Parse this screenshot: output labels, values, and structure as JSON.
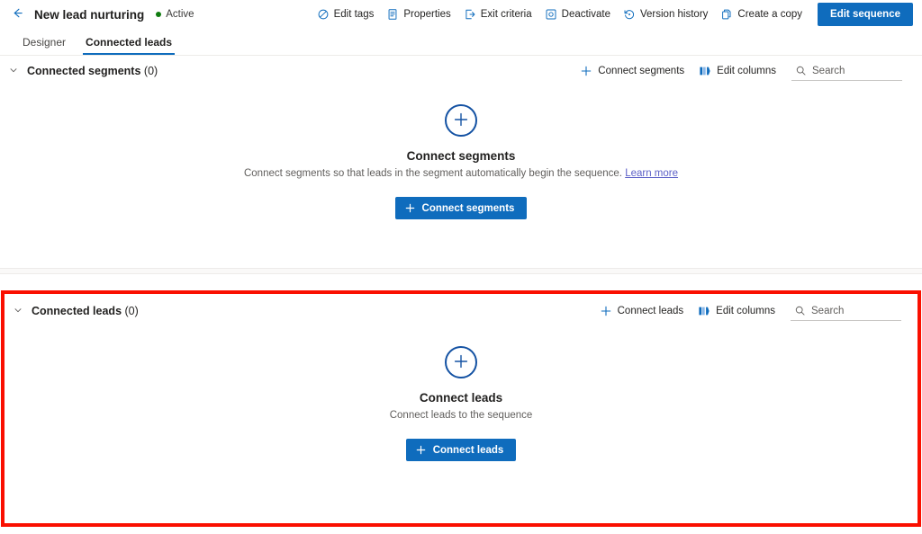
{
  "commandbar": {
    "back_icon": "arrow-left-icon",
    "title": "New lead nurturing",
    "status": "Active",
    "status_color": "#107c10",
    "actions": [
      {
        "label": "Edit tags",
        "icon": "tag-icon"
      },
      {
        "label": "Properties",
        "icon": "document-properties-icon"
      },
      {
        "label": "Exit criteria",
        "icon": "exit-icon"
      },
      {
        "label": "Deactivate",
        "icon": "deactivate-icon"
      },
      {
        "label": "Version history",
        "icon": "history-icon"
      },
      {
        "label": "Create a copy",
        "icon": "copy-icon"
      }
    ],
    "primary_button": {
      "label": "Edit sequence",
      "color": "#0f6cbd"
    }
  },
  "tabs": [
    {
      "label": "Designer",
      "active": false
    },
    {
      "label": "Connected leads",
      "active": true
    }
  ],
  "segments_section": {
    "chevron_icon": "chevron-down-icon",
    "title": "Connected segments",
    "count": "(0)",
    "actions": [
      {
        "label": "Connect segments",
        "icon": "plus-icon"
      },
      {
        "label": "Edit columns",
        "icon": "edit-columns-icon"
      }
    ],
    "search": {
      "placeholder": "Search",
      "value": "",
      "icon": "search-icon"
    },
    "empty": {
      "circle_icon": "plus-circle-icon",
      "title": "Connect segments",
      "description": "Connect segments so that leads in the segment automatically begin the sequence.",
      "link": "Learn more",
      "button_label": "Connect segments",
      "button_icon": "plus-icon"
    }
  },
  "leads_section": {
    "highlight_color": "#fa0f00",
    "chevron_icon": "chevron-down-icon",
    "title": "Connected leads",
    "count": "(0)",
    "actions": [
      {
        "label": "Connect leads",
        "icon": "plus-icon"
      },
      {
        "label": "Edit columns",
        "icon": "edit-columns-icon"
      }
    ],
    "search": {
      "placeholder": "Search",
      "value": "",
      "icon": "search-icon"
    },
    "empty": {
      "circle_icon": "plus-circle-icon",
      "title": "Connect leads",
      "description": "Connect leads to the sequence",
      "button_label": "Connect leads",
      "button_icon": "plus-icon"
    }
  }
}
